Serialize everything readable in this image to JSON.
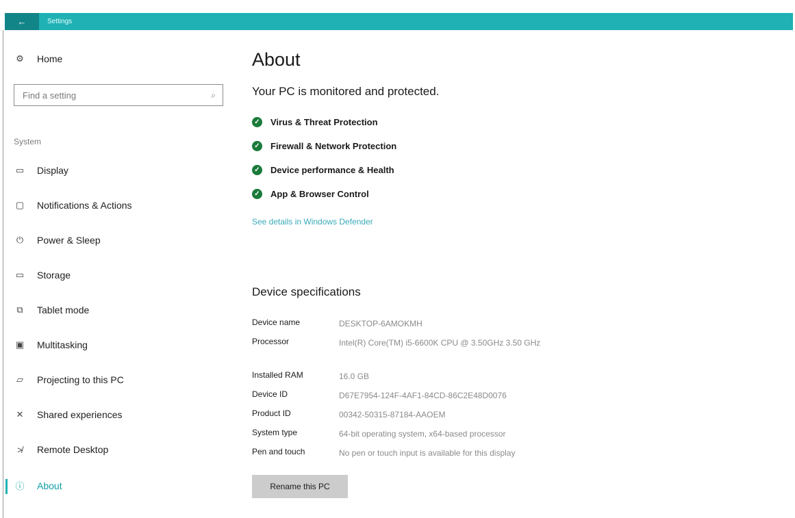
{
  "titlebar": {
    "back_icon": "←",
    "title": "Settings"
  },
  "sidebar": {
    "home": {
      "icon": "gear-icon",
      "glyph": "⚙",
      "label": "Home"
    },
    "search": {
      "placeholder": "Find a setting",
      "icon_glyph": "⌕"
    },
    "section_label": "System",
    "items": [
      {
        "glyph": "▭",
        "label": "Display"
      },
      {
        "glyph": "▢",
        "label": "Notifications & Actions"
      },
      {
        "glyph": "⏻",
        "label": "Power & Sleep"
      },
      {
        "glyph": "▭",
        "label": "Storage"
      },
      {
        "glyph": "⧉",
        "label": "Tablet mode"
      },
      {
        "glyph": "▣",
        "label": "Multitasking"
      },
      {
        "glyph": "▱",
        "label": "Projecting to this PC"
      },
      {
        "glyph": "✕",
        "label": "Shared experiences"
      },
      {
        "glyph": "≯",
        "label": "Remote Desktop"
      },
      {
        "glyph": "ⓘ",
        "label": "About"
      }
    ],
    "active_item": "About"
  },
  "main": {
    "title": "About",
    "subtitle": "Your PC is monitored and protected.",
    "check_glyph": "✓",
    "protections": [
      "Virus & Threat Protection",
      "Firewall & Network Protection",
      "Device performance & Health",
      "App & Browser Control"
    ],
    "defender_link": "See details in Windows Defender",
    "specs_heading": "Device specifications",
    "specs": [
      {
        "key": "Device name",
        "value": "DESKTOP-6AMOKMH"
      },
      {
        "key": "Processor",
        "value": "Intel(R) Core(TM) i5-6600K CPU @ 3.50GHz   3.50 GHz"
      },
      {
        "key": "Installed RAM",
        "value": "16.0 GB"
      },
      {
        "key": "Device ID",
        "value": "D67E7954-124F-4AF1-84CD-86C2E48D0076"
      },
      {
        "key": "Product ID",
        "value": "00342-50315-87184-AAOEM"
      },
      {
        "key": "System type",
        "value": "64-bit operating system, x64-based processor"
      },
      {
        "key": "Pen and touch",
        "value": "No pen or touch input is available for this display"
      }
    ],
    "rename_button": "Rename this PC"
  },
  "colors": {
    "titlebar": "#1fb1b4",
    "back_button": "#128589",
    "accent": "#0f9ea6",
    "check": "#1a7b3a",
    "link": "#3aa9b8"
  }
}
